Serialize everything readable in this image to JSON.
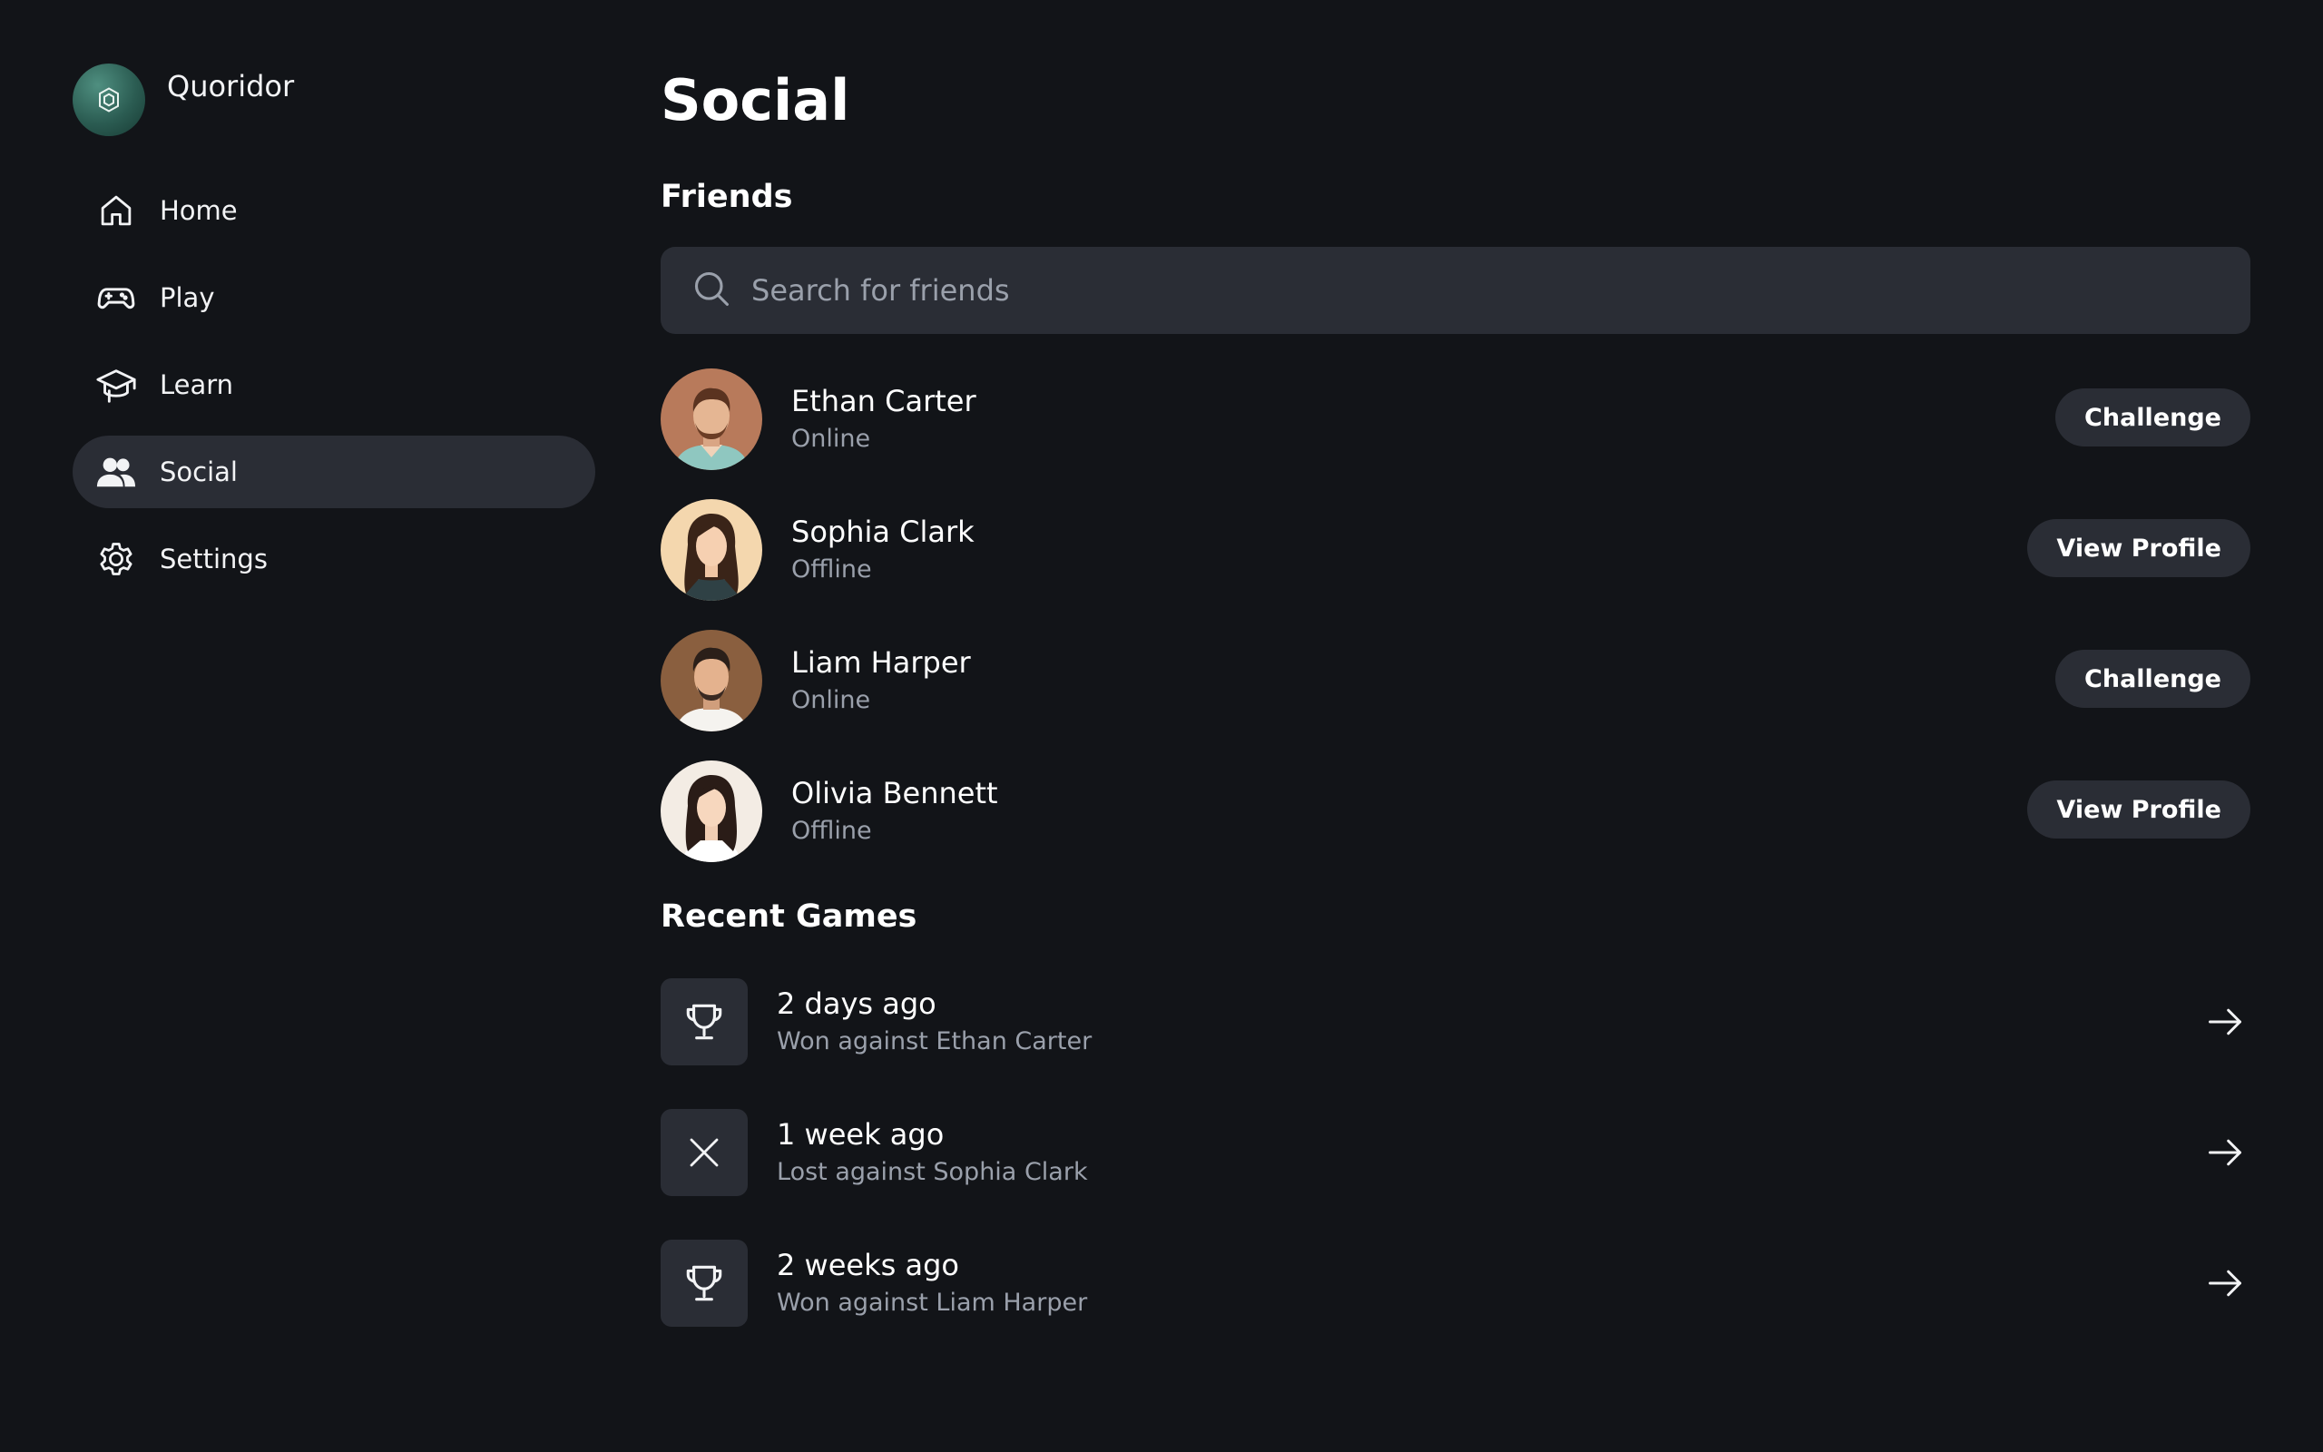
{
  "app": {
    "name": "Quoridor",
    "logo_icon": "cube-logo-icon"
  },
  "sidebar": {
    "items": [
      {
        "label": "Home",
        "icon": "home-icon",
        "active": false
      },
      {
        "label": "Play",
        "icon": "gamepad-icon",
        "active": false
      },
      {
        "label": "Learn",
        "icon": "graduation-cap-icon",
        "active": false
      },
      {
        "label": "Social",
        "icon": "users-icon",
        "active": true
      },
      {
        "label": "Settings",
        "icon": "gear-icon",
        "active": false
      }
    ]
  },
  "page": {
    "title": "Social"
  },
  "friends": {
    "title": "Friends",
    "search": {
      "placeholder": "Search for friends",
      "value": "",
      "icon": "search-icon"
    },
    "list": [
      {
        "name": "Ethan Carter",
        "status": "Online",
        "action": "Challenge"
      },
      {
        "name": "Sophia Clark",
        "status": "Offline",
        "action": "View Profile"
      },
      {
        "name": "Liam Harper",
        "status": "Online",
        "action": "Challenge"
      },
      {
        "name": "Olivia Bennett",
        "status": "Offline",
        "action": "View Profile"
      }
    ]
  },
  "recent_games": {
    "title": "Recent Games",
    "list": [
      {
        "when": "2 days ago",
        "result": "Won against Ethan Carter",
        "icon": "trophy-icon"
      },
      {
        "when": "1 week ago",
        "result": "Lost against Sophia Clark",
        "icon": "close-icon"
      },
      {
        "when": "2 weeks ago",
        "result": "Won against Liam Harper",
        "icon": "trophy-icon"
      }
    ]
  },
  "colors": {
    "background": "#121418",
    "surface": "#2a2d35",
    "text_primary": "#ffffff",
    "text_secondary": "#9aa0ab"
  }
}
